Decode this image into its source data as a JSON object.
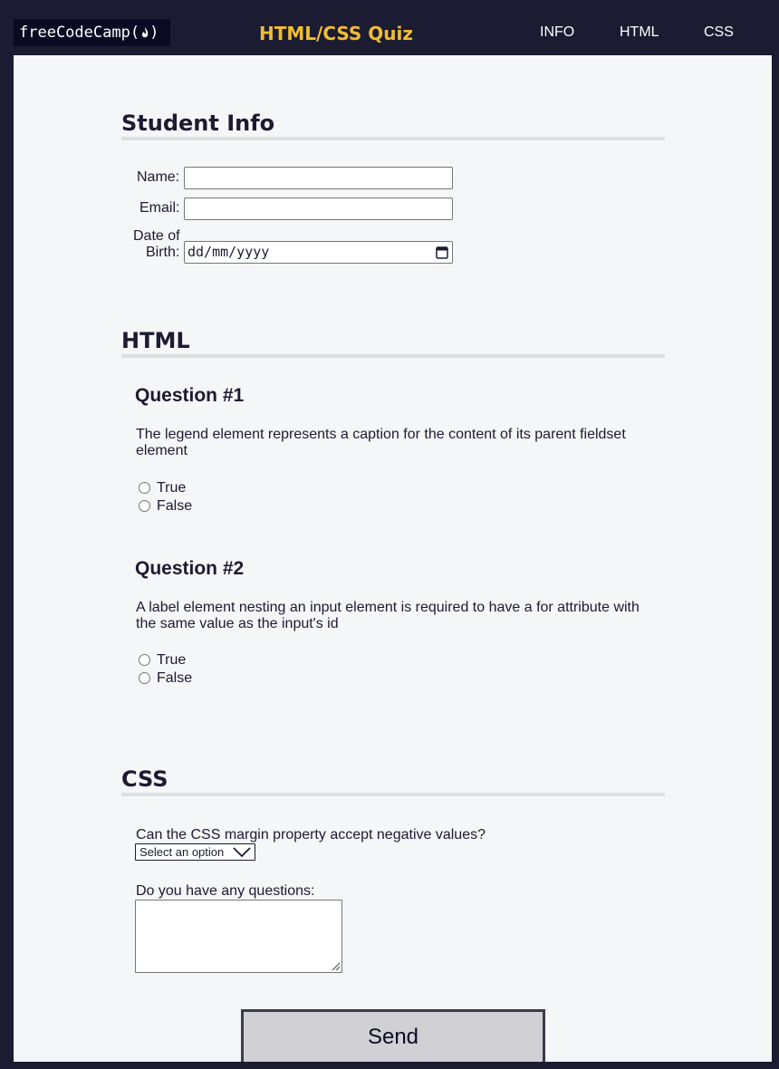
{
  "header": {
    "logo_text": "freeCodeCamp(",
    "logo_close": ")",
    "title": "HTML/CSS Quiz",
    "nav": [
      "INFO",
      "HTML",
      "CSS"
    ]
  },
  "student_info": {
    "heading": "Student Info",
    "name_label": "Name:",
    "email_label": "Email:",
    "dob_label_line1": "Date of",
    "dob_label_line2": "Birth:",
    "dob_placeholder": "dd/mm/yyyy"
  },
  "html_section": {
    "heading": "HTML",
    "questions": [
      {
        "title": "Question #1",
        "text": "The legend element represents a caption for the content of its parent fieldset element",
        "options": [
          "True",
          "False"
        ]
      },
      {
        "title": "Question #2",
        "text": "A label element nesting an input element is required to have a for attribute with the same value as the input's id",
        "options": [
          "True",
          "False"
        ]
      }
    ]
  },
  "css_section": {
    "heading": "CSS",
    "margin_question": "Can the CSS margin property accept negative values?",
    "select_value": "Select an option",
    "questions_label": "Do you have any questions:"
  },
  "send_label": "Send",
  "colors": {
    "page_bg": "#1b1b32",
    "content_bg": "#f5f6f7",
    "accent": "#f1be32",
    "button_bg": "#d0d0d5"
  }
}
